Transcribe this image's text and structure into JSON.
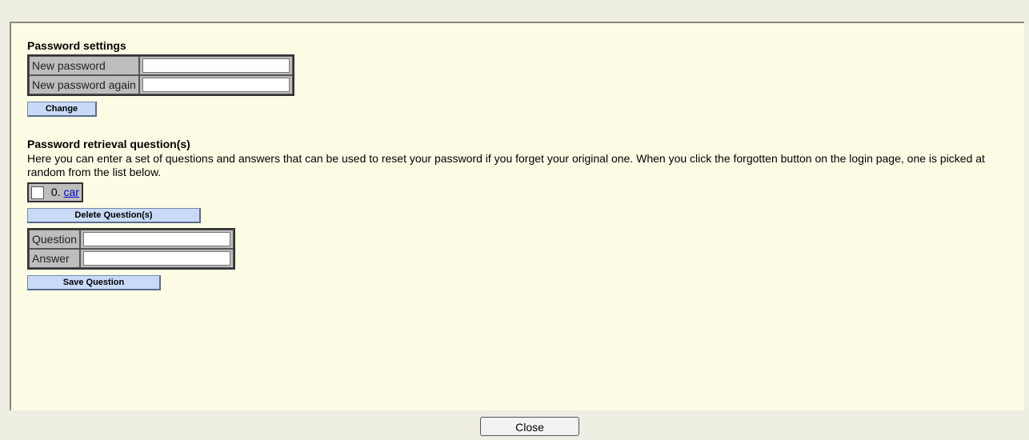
{
  "password_settings": {
    "heading": "Password settings",
    "new_password_label": "New password",
    "new_password_value": "",
    "new_password_again_label": "New password again",
    "new_password_again_value": "",
    "change_button": "Change"
  },
  "retrieval": {
    "heading": "Password retrieval question(s)",
    "description": "Here you can enter a set of questions and answers that can be used to reset your password if you forget your original one. When you click the forgotten button on the login page, one is picked at random from the list below.",
    "questions": [
      {
        "number": "0.",
        "text": "car",
        "checked": false
      }
    ],
    "delete_button": "Delete Question(s)",
    "question_label": "Question",
    "question_value": "",
    "answer_label": "Answer",
    "answer_value": "",
    "save_button": "Save Question"
  },
  "footer": {
    "close_button": "Close"
  },
  "colors": {
    "panel_bg": "#fdfde6",
    "button_bg": "#c9daf8",
    "link": "#0000cc"
  }
}
